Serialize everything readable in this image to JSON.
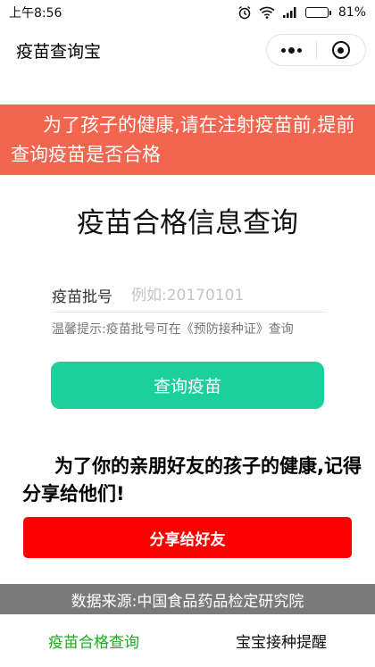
{
  "status_bar": {
    "time": "上午8:56",
    "battery": "81%",
    "battery_level": 0.81,
    "icons": [
      "alarm-icon",
      "wifi-icon",
      "signal-icon",
      "battery-icon"
    ]
  },
  "nav": {
    "title": "疫苗查询宝",
    "menu_icon": "more-dots-icon",
    "close_icon": "target-circle-icon"
  },
  "banner": {
    "text": "为了孩子的健康,请在注射疫苗前,提前查询疫苗是否合格"
  },
  "main": {
    "title": "疫苗合格信息查询",
    "input_label": "疫苗批号",
    "input_placeholder": "例如:20170101",
    "input_value": "",
    "tip": "温馨提示:疫苗批号可在《预防接种证》查询",
    "query_button": "查询疫苗"
  },
  "share": {
    "text": "为了你的亲朋好友的孩子的健康,记得分享给他们!",
    "button": "分享给好友"
  },
  "source": {
    "text": "数据来源:中国食品药品检定研究院"
  },
  "tabs": [
    {
      "label": "疫苗合格查询",
      "active": true
    },
    {
      "label": "宝宝接种提醒",
      "active": false
    }
  ],
  "colors": {
    "banner": "#f2654f",
    "query_button": "#1dd09b",
    "share_button": "#fc0000",
    "source_bar": "#7a7a7a",
    "tab_active": "#1aad19"
  }
}
